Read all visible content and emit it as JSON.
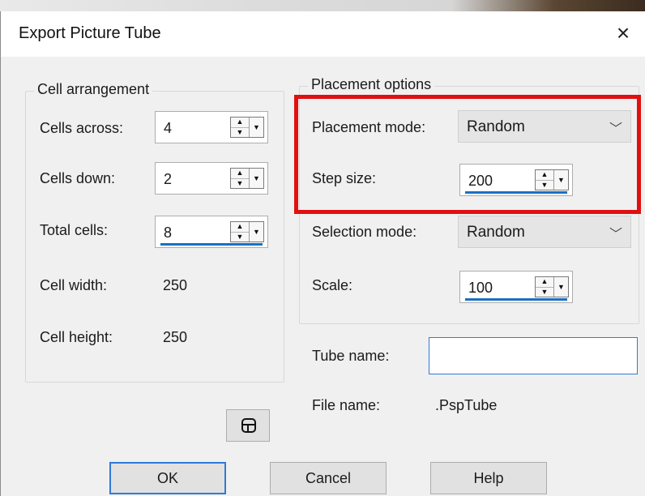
{
  "window": {
    "title": "Export Picture Tube",
    "close_glyph": "×"
  },
  "cell_arrangement": {
    "legend": "Cell arrangement",
    "cells_across": {
      "label": "Cells across:",
      "value": "4"
    },
    "cells_down": {
      "label": "Cells down:",
      "value": "2"
    },
    "total_cells": {
      "label": "Total cells:",
      "value": "8"
    },
    "cell_width": {
      "label": "Cell width:",
      "value": "250"
    },
    "cell_height": {
      "label": "Cell height:",
      "value": "250"
    }
  },
  "placement_options": {
    "legend": "Placement options",
    "placement_mode": {
      "label": "Placement mode:",
      "value": "Random"
    },
    "step_size": {
      "label": "Step size:",
      "value": "200"
    },
    "selection_mode": {
      "label": "Selection mode:",
      "value": "Random"
    },
    "scale": {
      "label": "Scale:",
      "value": "100"
    }
  },
  "tube_name": {
    "label": "Tube name:",
    "value": ""
  },
  "file_name": {
    "label": "File name:",
    "value": ".PspTube"
  },
  "buttons": {
    "ok": "OK",
    "cancel": "Cancel",
    "help": "Help"
  },
  "icons": {
    "close": "close-icon",
    "chevron": "chevron-down-icon",
    "rounded_square": "rounded-square-icon"
  },
  "colors": {
    "highlight": "#e01010",
    "focus": "#1a6fc2",
    "dialog_bg": "#f0f0f0"
  }
}
